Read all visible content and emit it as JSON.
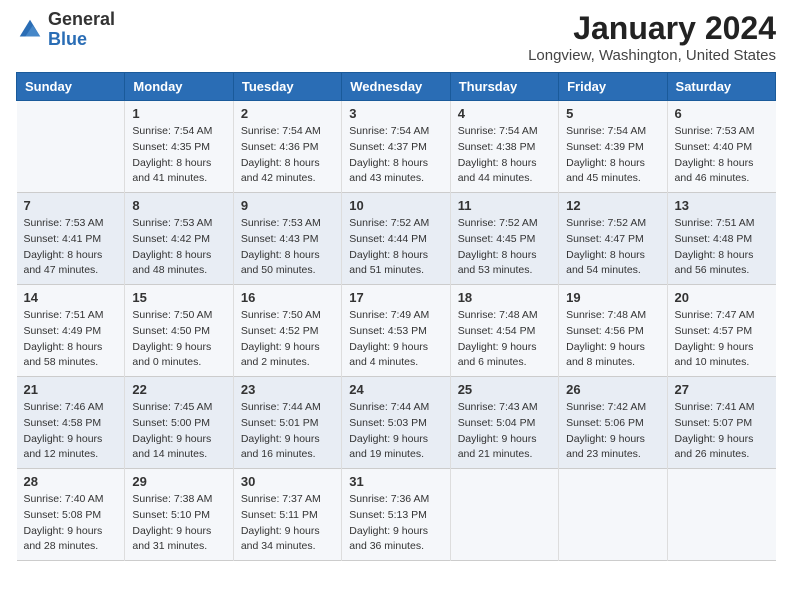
{
  "header": {
    "logo_general": "General",
    "logo_blue": "Blue",
    "month_title": "January 2024",
    "location": "Longview, Washington, United States"
  },
  "calendar": {
    "days_of_week": [
      "Sunday",
      "Monday",
      "Tuesday",
      "Wednesday",
      "Thursday",
      "Friday",
      "Saturday"
    ],
    "weeks": [
      [
        {
          "day": "",
          "sunrise": "",
          "sunset": "",
          "daylight": ""
        },
        {
          "day": "1",
          "sunrise": "Sunrise: 7:54 AM",
          "sunset": "Sunset: 4:35 PM",
          "daylight": "Daylight: 8 hours and 41 minutes."
        },
        {
          "day": "2",
          "sunrise": "Sunrise: 7:54 AM",
          "sunset": "Sunset: 4:36 PM",
          "daylight": "Daylight: 8 hours and 42 minutes."
        },
        {
          "day": "3",
          "sunrise": "Sunrise: 7:54 AM",
          "sunset": "Sunset: 4:37 PM",
          "daylight": "Daylight: 8 hours and 43 minutes."
        },
        {
          "day": "4",
          "sunrise": "Sunrise: 7:54 AM",
          "sunset": "Sunset: 4:38 PM",
          "daylight": "Daylight: 8 hours and 44 minutes."
        },
        {
          "day": "5",
          "sunrise": "Sunrise: 7:54 AM",
          "sunset": "Sunset: 4:39 PM",
          "daylight": "Daylight: 8 hours and 45 minutes."
        },
        {
          "day": "6",
          "sunrise": "Sunrise: 7:53 AM",
          "sunset": "Sunset: 4:40 PM",
          "daylight": "Daylight: 8 hours and 46 minutes."
        }
      ],
      [
        {
          "day": "7",
          "sunrise": "Sunrise: 7:53 AM",
          "sunset": "Sunset: 4:41 PM",
          "daylight": "Daylight: 8 hours and 47 minutes."
        },
        {
          "day": "8",
          "sunrise": "Sunrise: 7:53 AM",
          "sunset": "Sunset: 4:42 PM",
          "daylight": "Daylight: 8 hours and 48 minutes."
        },
        {
          "day": "9",
          "sunrise": "Sunrise: 7:53 AM",
          "sunset": "Sunset: 4:43 PM",
          "daylight": "Daylight: 8 hours and 50 minutes."
        },
        {
          "day": "10",
          "sunrise": "Sunrise: 7:52 AM",
          "sunset": "Sunset: 4:44 PM",
          "daylight": "Daylight: 8 hours and 51 minutes."
        },
        {
          "day": "11",
          "sunrise": "Sunrise: 7:52 AM",
          "sunset": "Sunset: 4:45 PM",
          "daylight": "Daylight: 8 hours and 53 minutes."
        },
        {
          "day": "12",
          "sunrise": "Sunrise: 7:52 AM",
          "sunset": "Sunset: 4:47 PM",
          "daylight": "Daylight: 8 hours and 54 minutes."
        },
        {
          "day": "13",
          "sunrise": "Sunrise: 7:51 AM",
          "sunset": "Sunset: 4:48 PM",
          "daylight": "Daylight: 8 hours and 56 minutes."
        }
      ],
      [
        {
          "day": "14",
          "sunrise": "Sunrise: 7:51 AM",
          "sunset": "Sunset: 4:49 PM",
          "daylight": "Daylight: 8 hours and 58 minutes."
        },
        {
          "day": "15",
          "sunrise": "Sunrise: 7:50 AM",
          "sunset": "Sunset: 4:50 PM",
          "daylight": "Daylight: 9 hours and 0 minutes."
        },
        {
          "day": "16",
          "sunrise": "Sunrise: 7:50 AM",
          "sunset": "Sunset: 4:52 PM",
          "daylight": "Daylight: 9 hours and 2 minutes."
        },
        {
          "day": "17",
          "sunrise": "Sunrise: 7:49 AM",
          "sunset": "Sunset: 4:53 PM",
          "daylight": "Daylight: 9 hours and 4 minutes."
        },
        {
          "day": "18",
          "sunrise": "Sunrise: 7:48 AM",
          "sunset": "Sunset: 4:54 PM",
          "daylight": "Daylight: 9 hours and 6 minutes."
        },
        {
          "day": "19",
          "sunrise": "Sunrise: 7:48 AM",
          "sunset": "Sunset: 4:56 PM",
          "daylight": "Daylight: 9 hours and 8 minutes."
        },
        {
          "day": "20",
          "sunrise": "Sunrise: 7:47 AM",
          "sunset": "Sunset: 4:57 PM",
          "daylight": "Daylight: 9 hours and 10 minutes."
        }
      ],
      [
        {
          "day": "21",
          "sunrise": "Sunrise: 7:46 AM",
          "sunset": "Sunset: 4:58 PM",
          "daylight": "Daylight: 9 hours and 12 minutes."
        },
        {
          "day": "22",
          "sunrise": "Sunrise: 7:45 AM",
          "sunset": "Sunset: 5:00 PM",
          "daylight": "Daylight: 9 hours and 14 minutes."
        },
        {
          "day": "23",
          "sunrise": "Sunrise: 7:44 AM",
          "sunset": "Sunset: 5:01 PM",
          "daylight": "Daylight: 9 hours and 16 minutes."
        },
        {
          "day": "24",
          "sunrise": "Sunrise: 7:44 AM",
          "sunset": "Sunset: 5:03 PM",
          "daylight": "Daylight: 9 hours and 19 minutes."
        },
        {
          "day": "25",
          "sunrise": "Sunrise: 7:43 AM",
          "sunset": "Sunset: 5:04 PM",
          "daylight": "Daylight: 9 hours and 21 minutes."
        },
        {
          "day": "26",
          "sunrise": "Sunrise: 7:42 AM",
          "sunset": "Sunset: 5:06 PM",
          "daylight": "Daylight: 9 hours and 23 minutes."
        },
        {
          "day": "27",
          "sunrise": "Sunrise: 7:41 AM",
          "sunset": "Sunset: 5:07 PM",
          "daylight": "Daylight: 9 hours and 26 minutes."
        }
      ],
      [
        {
          "day": "28",
          "sunrise": "Sunrise: 7:40 AM",
          "sunset": "Sunset: 5:08 PM",
          "daylight": "Daylight: 9 hours and 28 minutes."
        },
        {
          "day": "29",
          "sunrise": "Sunrise: 7:38 AM",
          "sunset": "Sunset: 5:10 PM",
          "daylight": "Daylight: 9 hours and 31 minutes."
        },
        {
          "day": "30",
          "sunrise": "Sunrise: 7:37 AM",
          "sunset": "Sunset: 5:11 PM",
          "daylight": "Daylight: 9 hours and 34 minutes."
        },
        {
          "day": "31",
          "sunrise": "Sunrise: 7:36 AM",
          "sunset": "Sunset: 5:13 PM",
          "daylight": "Daylight: 9 hours and 36 minutes."
        },
        {
          "day": "",
          "sunrise": "",
          "sunset": "",
          "daylight": ""
        },
        {
          "day": "",
          "sunrise": "",
          "sunset": "",
          "daylight": ""
        },
        {
          "day": "",
          "sunrise": "",
          "sunset": "",
          "daylight": ""
        }
      ]
    ]
  }
}
